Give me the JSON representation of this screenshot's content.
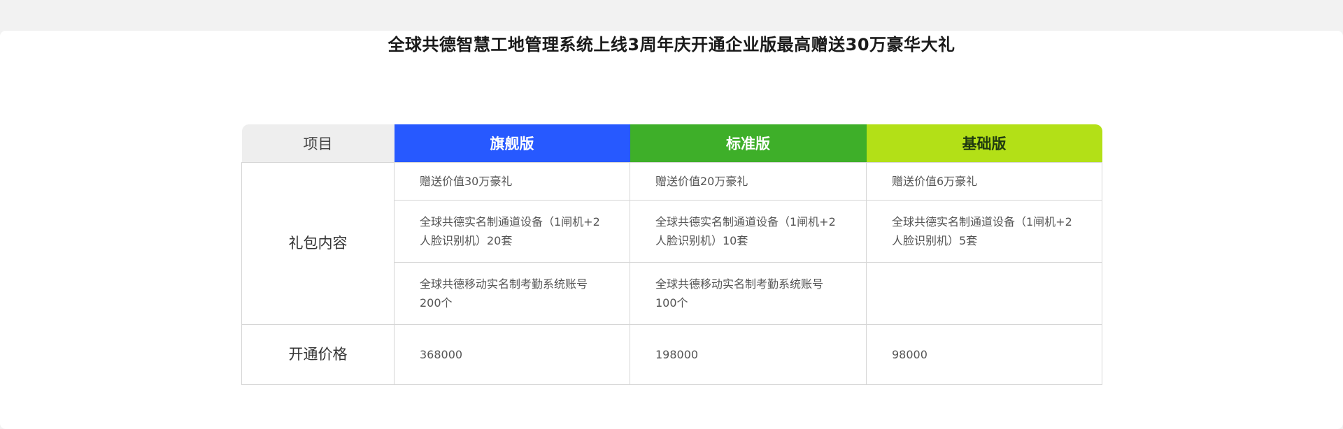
{
  "title": "全球共德智慧工地管理系统上线3周年庆开通企业版最高赠送30万豪华大礼",
  "colors": {
    "flagship": "#2759ff",
    "standard": "#3eaf29",
    "basic": "#b3e017",
    "item_header": "#eeeeee"
  },
  "table": {
    "headers": {
      "item": "项目",
      "flagship": "旗舰版",
      "standard": "标准版",
      "basic": "基础版"
    },
    "gift_label": "礼包内容",
    "gift_rows": [
      {
        "flagship": "赠送价值30万豪礼",
        "standard": "赠送价值20万豪礼",
        "basic": "赠送价值6万豪礼"
      },
      {
        "flagship": "全球共德实名制通道设备（1闸机+2人脸识别机）20套",
        "standard": "全球共德实名制通道设备（1闸机+2人脸识别机）10套",
        "basic": "全球共德实名制通道设备（1闸机+2人脸识别机）5套"
      },
      {
        "flagship": "全球共德移动实名制考勤系统账号200个",
        "standard": "全球共德移动实名制考勤系统账号100个",
        "basic": ""
      }
    ],
    "price_label": "开通价格",
    "prices": {
      "flagship": "368000",
      "standard": "198000",
      "basic": "98000"
    }
  }
}
